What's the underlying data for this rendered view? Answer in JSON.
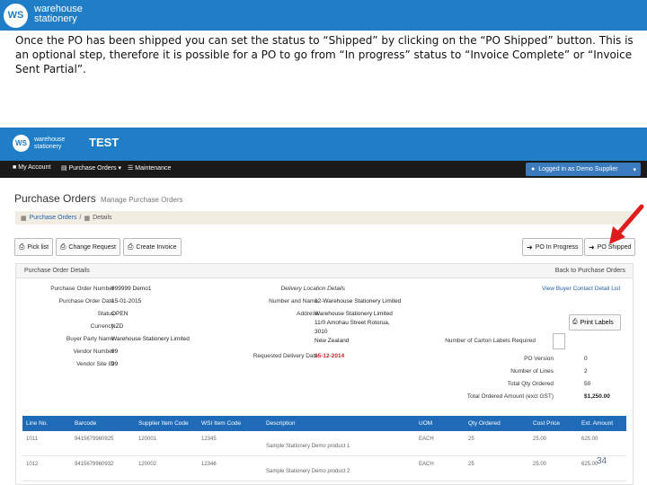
{
  "banner": {
    "logo_text": "WS",
    "brand_line1": "warehouse",
    "brand_line2": "stationery"
  },
  "caption": "Once the PO has been shipped you can set the status to “Shipped” by clicking on the “PO Shipped” button.  This is an optional step, therefore it is possible for a PO to go from “In progress” status to “Invoice Complete” or “Invoice Sent Partial”.",
  "app": {
    "logo_text": "WS",
    "brand_line1": "warehouse",
    "brand_line2": "stationery",
    "env_title": "TEST",
    "nav": {
      "my_account": "My Account",
      "purchase_orders": "Purchase Orders",
      "maintenance": "Maintenance",
      "logged_in": "Logged in as Demo Supplier"
    },
    "page_title": "Purchase Orders",
    "page_subtitle": "Manage Purchase Orders",
    "breadcrumb": {
      "item1": "Purchase Orders",
      "sep": "/",
      "item2": "Details"
    },
    "buttons": {
      "pick_list": "Pick list",
      "change_request": "Change Request",
      "create_invoice": "Create Invoice",
      "po_in_progress": "PO In Progress",
      "po_shipped": "PO Shipped",
      "print_labels": "Print Labels"
    },
    "details": {
      "panel_title": "Purchase Order Details",
      "back_link": "Back to Purchase Orders",
      "purchase_order_number_label": "Purchase Order Number",
      "purchase_order_number": "999999 Demo1",
      "purchase_order_date_label": "Purchase Order Date",
      "purchase_order_date": "15-01-2015",
      "status_label": "Status",
      "status": "OPEN",
      "currency_label": "Currency",
      "currency": "NZD",
      "buyer_party_name_label": "Buyer Party Name",
      "buyer_party_name": "Warehouse Stationery Limited",
      "vendor_number_label": "Vendor Number",
      "vendor_number": "99",
      "vendor_site_id_label": "Vendor Site ID",
      "vendor_site_id": "99",
      "delivery_location_details_label": "Delivery Location Details",
      "number_and_name_label": "Number and Name",
      "number_and_name": "12-Warehouse Stationery Limited",
      "address_label": "Address",
      "address_line1": "Warehouse Stationery Limited",
      "address_line2": "11/0 Amohau Street Rotorua,",
      "address_line3": "3010",
      "address_line4": "New Zealand",
      "requested_delivery_date_label": "Requested Delivery Date",
      "requested_delivery_date": "15-12-2014",
      "view_buyer_contact": "View Buyer Contact Detail List",
      "carton_labels_label": "Number of Carton Labels Required",
      "po_version_label": "PO Version",
      "po_version": "0",
      "number_of_lines_label": "Number of Lines",
      "number_of_lines": "2",
      "total_qty_ordered_label": "Total Qty Ordered",
      "total_qty_ordered": "50",
      "total_ordered_amount_label": "Total Ordered Amount (excl GST)",
      "total_ordered_amount": "$1,250.00"
    },
    "lines": {
      "headers": [
        "Line No.",
        "Barcode",
        "Supplier Item Code",
        "WSI Item Code",
        "Description",
        "UOM",
        "Qty Ordered",
        "Cost Price",
        "Ext. Amount"
      ],
      "rows": [
        [
          "1011",
          "9415679960925",
          "120001",
          "12345",
          "Sample Stationery Demo product 1",
          "EACH",
          "25",
          "25.00",
          "625.00"
        ],
        [
          "1012",
          "9415679960932",
          "120002",
          "12346",
          "Sample Stationery Demo product 2",
          "EACH",
          "25",
          "25.00",
          "625.00"
        ]
      ]
    }
  },
  "slide_number": "34",
  "colors": {
    "brand_blue": "#1f7ec6",
    "nav_dark": "#1a1a1a",
    "grid_header": "#1f6bb8",
    "arrow_red": "#e01b1b"
  }
}
